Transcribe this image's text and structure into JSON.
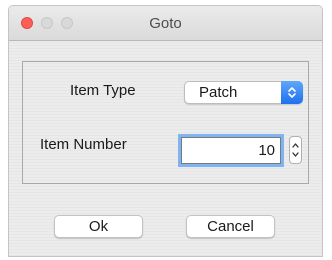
{
  "window": {
    "title": "Goto"
  },
  "form": {
    "item_type_label": "Item Type",
    "item_type_value": "Patch",
    "item_number_label": "Item Number",
    "item_number_value": "10"
  },
  "buttons": {
    "ok_label": "Ok",
    "cancel_label": "Cancel"
  },
  "icons": {
    "close": "close-icon",
    "minimize": "minimize-icon",
    "maximize": "maximize-icon",
    "select_arrows": "chevron-up-down-icon",
    "stepper_arrows": "chevron-up-down-icon"
  },
  "colors": {
    "accent": "#1d70f0",
    "focus_ring": "#7fb3f2",
    "close": "#fc5f57"
  }
}
